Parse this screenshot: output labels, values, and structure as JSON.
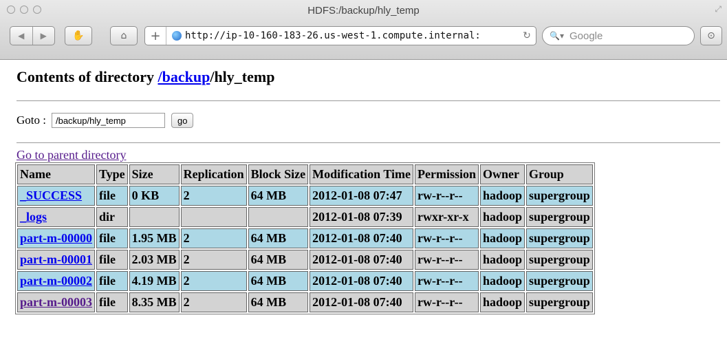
{
  "window": {
    "title": "HDFS:/backup/hly_temp"
  },
  "toolbar": {
    "back_icon": "◀",
    "forward_icon": "▶",
    "url": "http://ip-10-160-183-26.us-west-1.compute.internal:",
    "search_placeholder": "Google"
  },
  "page": {
    "heading_prefix": "Contents of directory ",
    "heading_link": "/backup",
    "heading_suffix": "/hly_temp",
    "goto_label": "Goto :",
    "goto_value": "/backup/hly_temp",
    "go_button": "go",
    "parent_link": "Go to parent directory"
  },
  "table": {
    "headers": [
      "Name",
      "Type",
      "Size",
      "Replication",
      "Block Size",
      "Modification Time",
      "Permission",
      "Owner",
      "Group"
    ],
    "rows": [
      [
        "_SUCCESS",
        "file",
        "0 KB",
        "2",
        "64 MB",
        "2012-01-08 07:47",
        "rw-r--r--",
        "hadoop",
        "supergroup"
      ],
      [
        "_logs",
        "dir",
        "",
        "",
        "",
        "2012-01-08 07:39",
        "rwxr-xr-x",
        "hadoop",
        "supergroup"
      ],
      [
        "part-m-00000",
        "file",
        "1.95 MB",
        "2",
        "64 MB",
        "2012-01-08 07:40",
        "rw-r--r--",
        "hadoop",
        "supergroup"
      ],
      [
        "part-m-00001",
        "file",
        "2.03 MB",
        "2",
        "64 MB",
        "2012-01-08 07:40",
        "rw-r--r--",
        "hadoop",
        "supergroup"
      ],
      [
        "part-m-00002",
        "file",
        "4.19 MB",
        "2",
        "64 MB",
        "2012-01-08 07:40",
        "rw-r--r--",
        "hadoop",
        "supergroup"
      ],
      [
        "part-m-00003",
        "file",
        "8.35 MB",
        "2",
        "64 MB",
        "2012-01-08 07:40",
        "rw-r--r--",
        "hadoop",
        "supergroup"
      ]
    ]
  },
  "colors": {
    "row_blue": "#add8e6",
    "row_grey": "#d3d3d3",
    "link": "#0000ee",
    "visited": "#551a8b"
  }
}
